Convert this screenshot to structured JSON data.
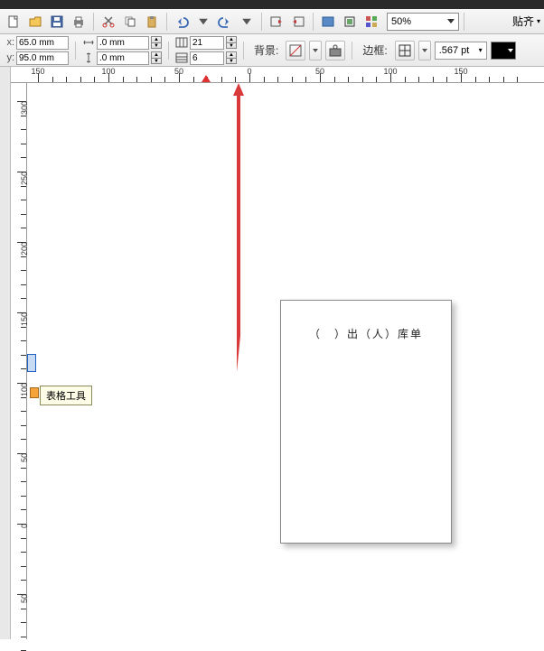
{
  "toolbar": {
    "zoom_value": "50%",
    "snap_label": "贴齐"
  },
  "props": {
    "x_label": "x:",
    "y_label": "y:",
    "x_value": "65.0 mm",
    "y_value": "95.0 mm",
    "w_value": ".0 mm",
    "h_value": ".0 mm",
    "cols_value": "21",
    "rows_value": "6",
    "bg_label": "背景:",
    "border_label": "边框:",
    "border_width": ".567 pt",
    "border_color": "#000000"
  },
  "ruler": {
    "h_ticks": [
      "150",
      "100",
      "50",
      "0",
      "50",
      "100",
      "150"
    ],
    "v_ticks": [
      "300",
      "250",
      "200",
      "150",
      "100",
      "50",
      "0",
      "50"
    ],
    "marker_x_px": 216
  },
  "canvas": {
    "document_text": "（　）出（人）库单"
  },
  "tooltip": {
    "text": "表格工具"
  }
}
